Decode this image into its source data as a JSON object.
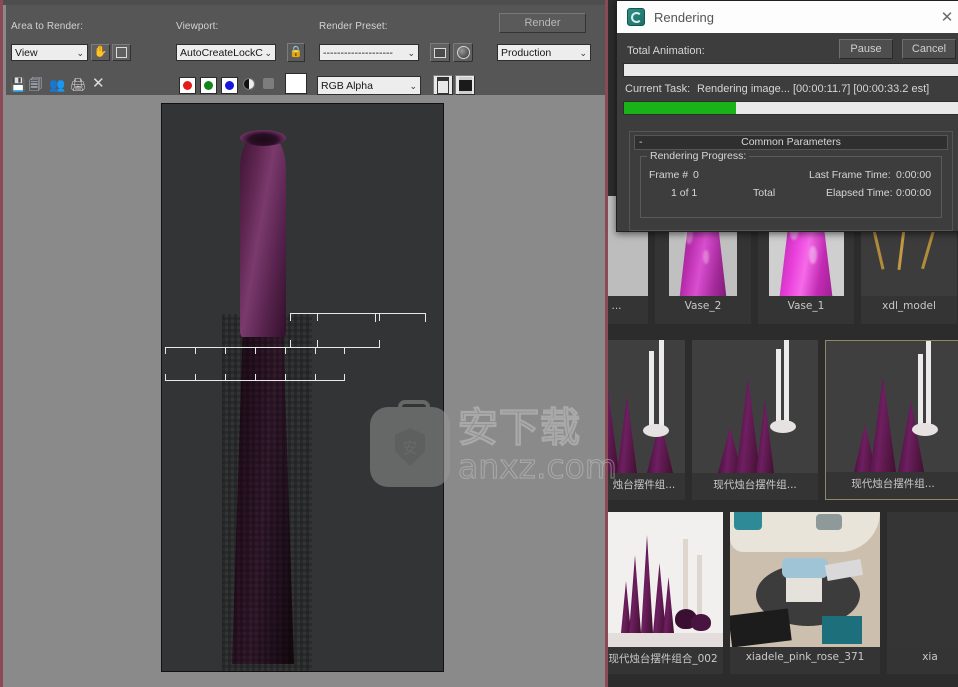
{
  "render_frame_window": {
    "toolbar": {
      "area_to_render_label": "Area to Render:",
      "area_to_render_value": "View",
      "viewport_label": "Viewport:",
      "viewport_value": "AutoCreateLockC",
      "render_preset_label": "Render Preset:",
      "render_preset_value": "--------------------",
      "render_button_label": "Render",
      "render_mode_value": "Production",
      "channel_value": "RGB Alpha",
      "icons": {
        "pan": "hand-icon",
        "region": "region-icon",
        "lock": "lock-icon",
        "setup": "render-setup-icon",
        "environment": "environment-icon",
        "save": "save-image-icon",
        "copy": "copy-image-icon",
        "clone": "clone-window-icon",
        "print": "print-image-icon",
        "clear": "clear-image-icon",
        "red": "red-channel-icon",
        "green": "green-channel-icon",
        "blue": "blue-channel-icon",
        "alpha": "alpha-channel-icon",
        "mono": "monochrome-icon",
        "swatch": "color-swatch",
        "toggle_ui": "toggle-ui-icon",
        "toggle_bg": "toggle-background-icon"
      }
    },
    "watermark": {
      "cn_text": "安下载",
      "url_text": "anxz.com",
      "badge_glyph": "安"
    }
  },
  "rendering_dialog": {
    "title": "Rendering",
    "icon": "3dsmax-app-icon",
    "close_label": "✕",
    "total_animation_label": "Total Animation:",
    "total_animation_progress": 0,
    "pause_button": "Pause",
    "cancel_button": "Cancel",
    "current_task_label": "Current Task:",
    "current_task_value": "Rendering image...  [00:00:11.7] [00:00:33.2 est]",
    "current_task_progress": 33,
    "progress_color": "#17b317",
    "rollout": {
      "title": "Common Parameters",
      "collapse_glyph": "-",
      "group_title": "Rendering Progress:",
      "frame_label": "Frame #",
      "frame_value": "0",
      "sequence_value": "1 of  1",
      "total_label": "Total",
      "last_frame_time_label": "Last Frame Time:",
      "last_frame_time_value": "0:00:00",
      "elapsed_time_label": "Elapsed Time:",
      "elapsed_time_value": "0:00:00"
    }
  },
  "asset_browser": {
    "rows": [
      {
        "cards": [
          {
            "name": "...",
            "kind": "vase-crop",
            "selected": false
          },
          {
            "name": "Vase_2",
            "kind": "vase",
            "selected": false
          },
          {
            "name": "Vase_1",
            "kind": "vase-light",
            "selected": false
          },
          {
            "name": "xdl_model",
            "kind": "chair",
            "selected": false
          }
        ]
      },
      {
        "cards": [
          {
            "name": "烛台摆件组...",
            "kind": "candles",
            "selected": false
          },
          {
            "name": "现代烛台摆件组...",
            "kind": "candles",
            "selected": false
          },
          {
            "name": "现代烛台摆件组...",
            "kind": "candles",
            "selected": true
          }
        ]
      },
      {
        "cards": [
          {
            "name": "现代烛台摆件组合_002",
            "kind": "white-scene",
            "selected": false
          },
          {
            "name": "xiadele_pink_rose_371",
            "kind": "room-scene",
            "selected": false
          },
          {
            "name": "xia",
            "kind": "dark",
            "selected": false
          }
        ]
      }
    ]
  }
}
